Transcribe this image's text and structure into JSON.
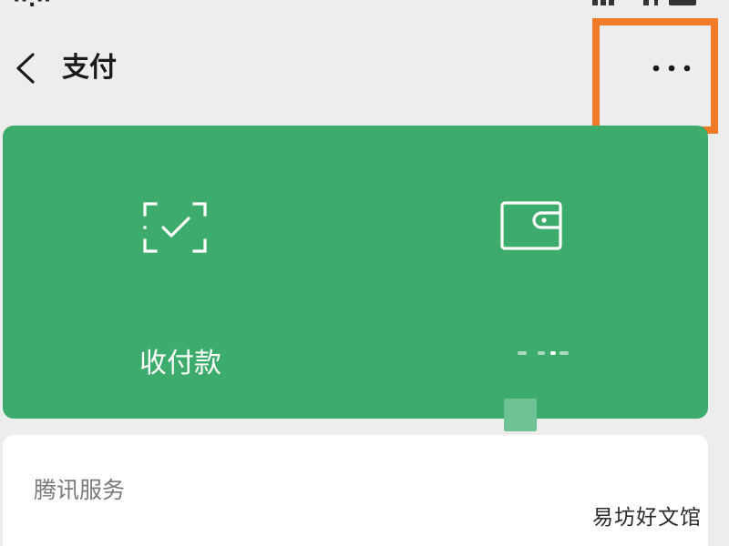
{
  "header": {
    "title": "支付",
    "back_icon": "chevron-left-icon",
    "more_icon": "more-horizontal-icon"
  },
  "payment_card": {
    "background": "#3dab6b",
    "pay_receive_label": "收付款",
    "pay_receive_icon": "scan-check-icon",
    "wallet_icon": "wallet-icon"
  },
  "services": {
    "section_title": "腾讯服务"
  },
  "watermark": "易坊好文馆",
  "colors": {
    "highlight": "#f07a28",
    "page_background": "#ededed",
    "card_green": "#3dab6b"
  }
}
